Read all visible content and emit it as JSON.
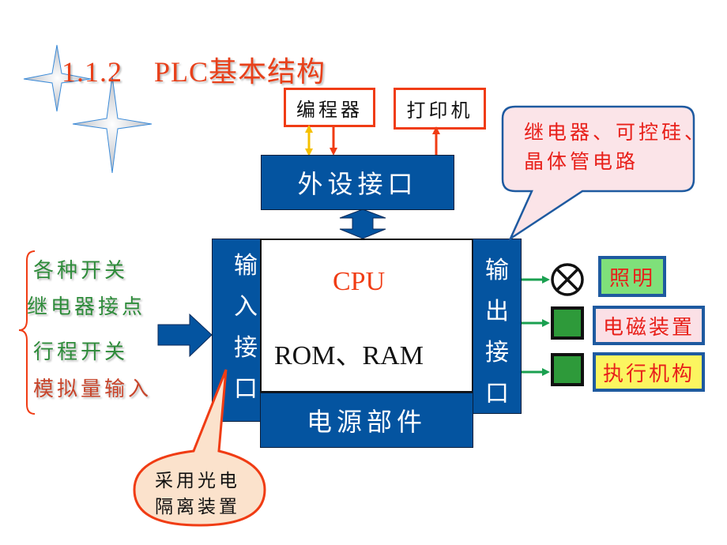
{
  "title": "1.1.2    PLC基本结构",
  "peripherals": {
    "programmer": "编程器",
    "printer": "打印机",
    "interface": "外设接口"
  },
  "core": {
    "input_interface": [
      "输",
      "入",
      "接",
      "口"
    ],
    "output_interface": [
      "输",
      "出",
      "接",
      "口"
    ],
    "cpu": "CPU",
    "memory": "ROM、RAM",
    "power": "电源部件"
  },
  "inputs": {
    "items": [
      {
        "label": "各种开关",
        "color": "#2e8b3a"
      },
      {
        "label": "继电器接点",
        "color": "#2e8b3a"
      },
      {
        "label": "行程开关",
        "color": "#2e8b3a"
      },
      {
        "label": "模拟量输入",
        "color": "#c8442a"
      }
    ]
  },
  "outputs": {
    "items": [
      {
        "label": "照明",
        "device": "lamp",
        "fill": "#7fe07a"
      },
      {
        "label": "电磁装置",
        "device": "coil",
        "fill": "#fbe0e6"
      },
      {
        "label": "执行机构",
        "device": "actuator",
        "fill": "#fbf560"
      }
    ]
  },
  "callouts": {
    "output_note_line1": "继电器、可控硅、",
    "output_note_line2": "晶体管电路",
    "input_note_line1": "采用光电",
    "input_note_line2": "隔离装置"
  },
  "colors": {
    "blue_block": "#0454a0",
    "title": "#e8401a",
    "arrow_green": "#1aa050",
    "arrow_red": "#f03c14",
    "arrow_yellow": "#f5c000"
  }
}
